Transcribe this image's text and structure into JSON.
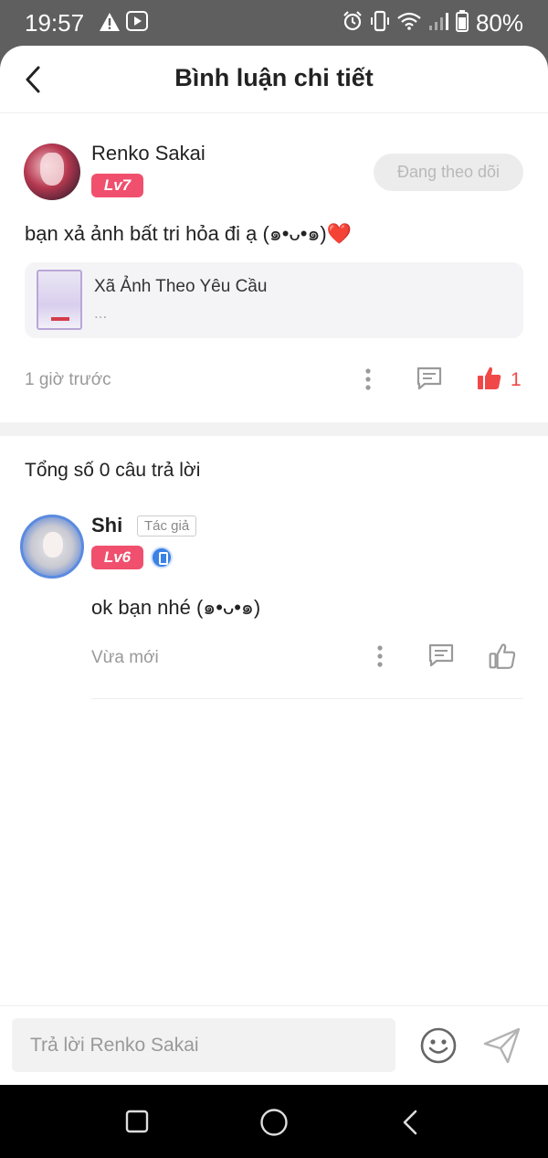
{
  "status_bar": {
    "time": "19:57",
    "battery": "80%"
  },
  "header": {
    "title": "Bình luận chi tiết"
  },
  "comment": {
    "username": "Renko Sakai",
    "level": "Lv7",
    "follow_label": "Đang theo dõi",
    "text": "bạn xả ảnh bất tri hỏa đi ạ (๑•ᴗ•๑)❤️",
    "reference": {
      "title": "Xã Ảnh Theo Yêu Cầu",
      "subtitle": "..."
    },
    "time": "1 giờ trước",
    "like_count": "1"
  },
  "replies_section": {
    "total": "Tổng số 0 câu trả lời"
  },
  "reply": {
    "username": "Shi",
    "author_tag": "Tác giả",
    "level": "Lv6",
    "text": "ok bạn nhé (๑•ᴗ•๑)",
    "time": "Vừa mới"
  },
  "input": {
    "placeholder": "Trả lời Renko Sakai"
  },
  "colors": {
    "accent": "#f0506e",
    "like_active": "#f04848",
    "verified": "#3b82e6"
  }
}
